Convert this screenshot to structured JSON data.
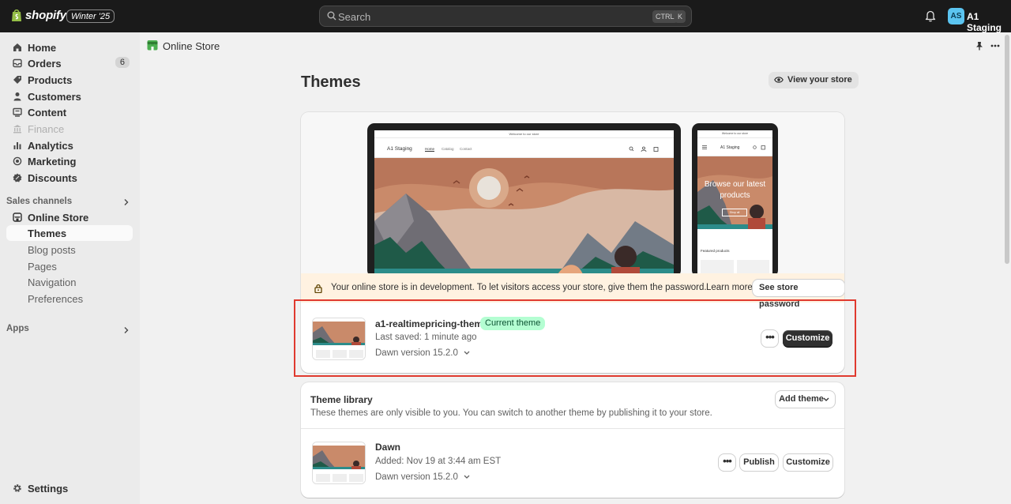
{
  "topbar": {
    "logo": "shopify",
    "edition": "Winter '25",
    "search_placeholder": "Search",
    "shortcut_key1": "CTRL",
    "shortcut_key2": "K",
    "avatar_initials": "AS",
    "store_name": "A1 Staging"
  },
  "sidebar": {
    "items": [
      {
        "label": "Home",
        "icon": "home-icon"
      },
      {
        "label": "Orders",
        "icon": "orders-icon",
        "count": "6"
      },
      {
        "label": "Products",
        "icon": "tag-icon"
      },
      {
        "label": "Customers",
        "icon": "person-icon"
      },
      {
        "label": "Content",
        "icon": "content-icon"
      },
      {
        "label": "Finance",
        "icon": "bank-icon",
        "disabled": true
      },
      {
        "label": "Analytics",
        "icon": "bar-chart-icon"
      },
      {
        "label": "Marketing",
        "icon": "target-icon"
      },
      {
        "label": "Discounts",
        "icon": "discount-icon"
      }
    ],
    "sales_channels_header": "Sales channels",
    "online_store": "Online Store",
    "sub_items": [
      "Themes",
      "Blog posts",
      "Pages",
      "Navigation",
      "Preferences"
    ],
    "apps_header": "Apps",
    "settings": "Settings"
  },
  "header": {
    "title": "Online Store"
  },
  "page": {
    "title": "Themes",
    "view_store_label": "View your store"
  },
  "preview": {
    "desktop_announcement": "Welcome to our store",
    "desktop_store_name": "A1 Staging",
    "desktop_nav": [
      "Home",
      "Catalog",
      "Contact"
    ],
    "mobile_announcement": "Welcome to our store",
    "mobile_store_name": "A1 Staging",
    "mobile_hero_text": "Browse our latest products",
    "mobile_hero_button": "Shop all",
    "mobile_featured": "Featured products"
  },
  "dev_banner": {
    "text": "Your online store is in development. To let visitors access your store, give them the password.",
    "learn_more": "Learn more",
    "button": "See store password"
  },
  "current_theme": {
    "name": "a1-realtimepricing-theme",
    "badge": "Current theme",
    "last_saved": "Last saved: 1 minute ago",
    "version": "Dawn version 15.2.0",
    "more_label": "•••",
    "customize_label": "Customize"
  },
  "library": {
    "title": "Theme library",
    "description": "These themes are only visible to you. You can switch to another theme by publishing it to your store.",
    "add_theme_label": "Add theme",
    "themes": [
      {
        "name": "Dawn",
        "added": "Added: Nov 19 at 3:44 am EST",
        "version": "Dawn version 15.2.0",
        "more_label": "•••",
        "publish_label": "Publish",
        "customize_label": "Customize"
      }
    ]
  },
  "colors": {
    "topbar_bg": "#1a1a1a",
    "sidebar_bg": "#ebebeb",
    "main_bg": "#f1f1f1",
    "current_badge_bg": "#b4fed2",
    "dev_banner_bg": "#fff2e1",
    "highlight_border": "#e03a2f",
    "primary_button": "#303030"
  }
}
